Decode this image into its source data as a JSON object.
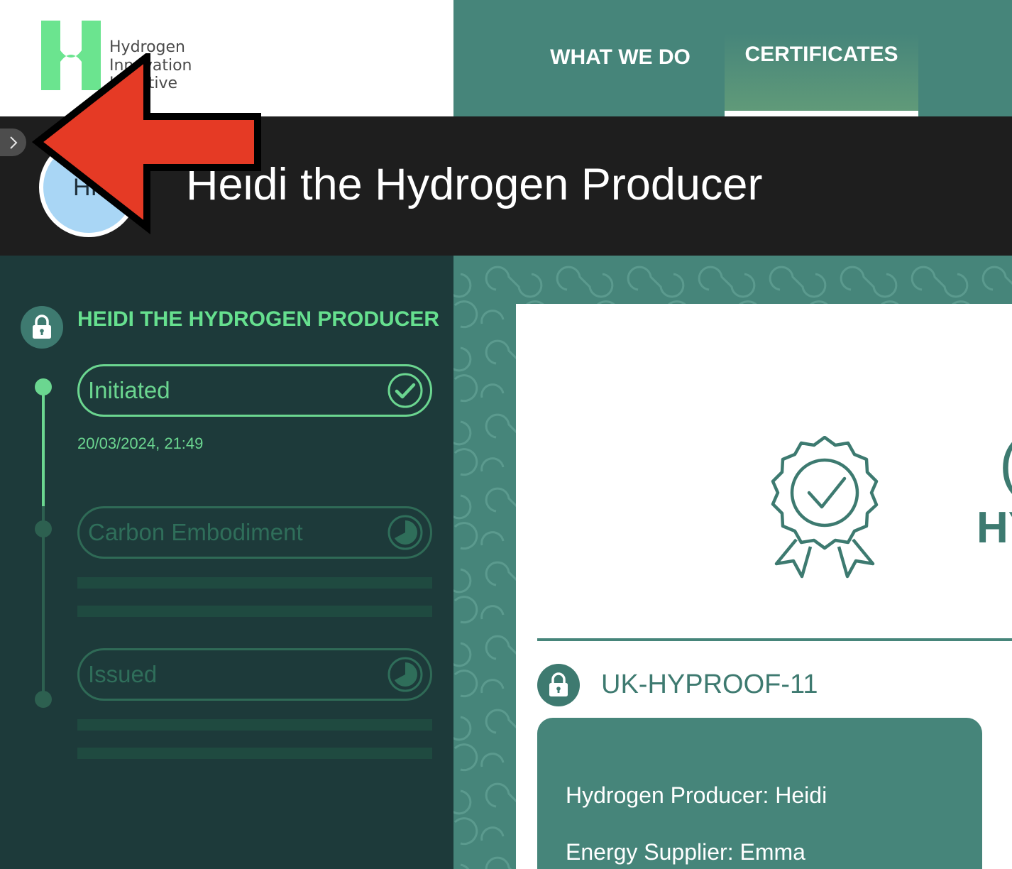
{
  "header": {
    "logo": {
      "line1": "Hydrogen",
      "line2": "Innovation",
      "line3": "Initiative",
      "color": "#6be48f"
    },
    "nav": {
      "what_we_do": "WHAT WE DO",
      "certificates": "CERTIFICATES",
      "active": "CERTIFICATES"
    },
    "background": "#46857a"
  },
  "title_band": {
    "title": "Heidi the Hydrogen Producer",
    "avatar_initials": "HI",
    "toggle_icon": "chevron-right-icon",
    "annotation": "red-arrow-pointing-left"
  },
  "progress_panel": {
    "heading": "HEIDI THE HYDROGEN PRODUCER",
    "heading_icon": "lock-icon",
    "steps": [
      {
        "label": "Initiated",
        "status": "complete",
        "icon": "check-circle-icon",
        "timestamp": "20/03/2024, 21:49"
      },
      {
        "label": "Carbon Embodiment",
        "status": "pending",
        "icon": "pie-clock-icon"
      },
      {
        "label": "Issued",
        "status": "pending",
        "icon": "pie-clock-icon"
      }
    ],
    "accent_color": "#66e08f"
  },
  "certificate": {
    "badge_icon": "award-rosette-icon",
    "partial_heading": "HY",
    "partial_glyph": "(",
    "id": "UK-HYPROOF-11",
    "id_icon": "lock-icon",
    "details": {
      "producer": "Hydrogen Producer: Heidi",
      "supplier": "Energy Supplier: Emma"
    },
    "color": "#3e7a70"
  }
}
